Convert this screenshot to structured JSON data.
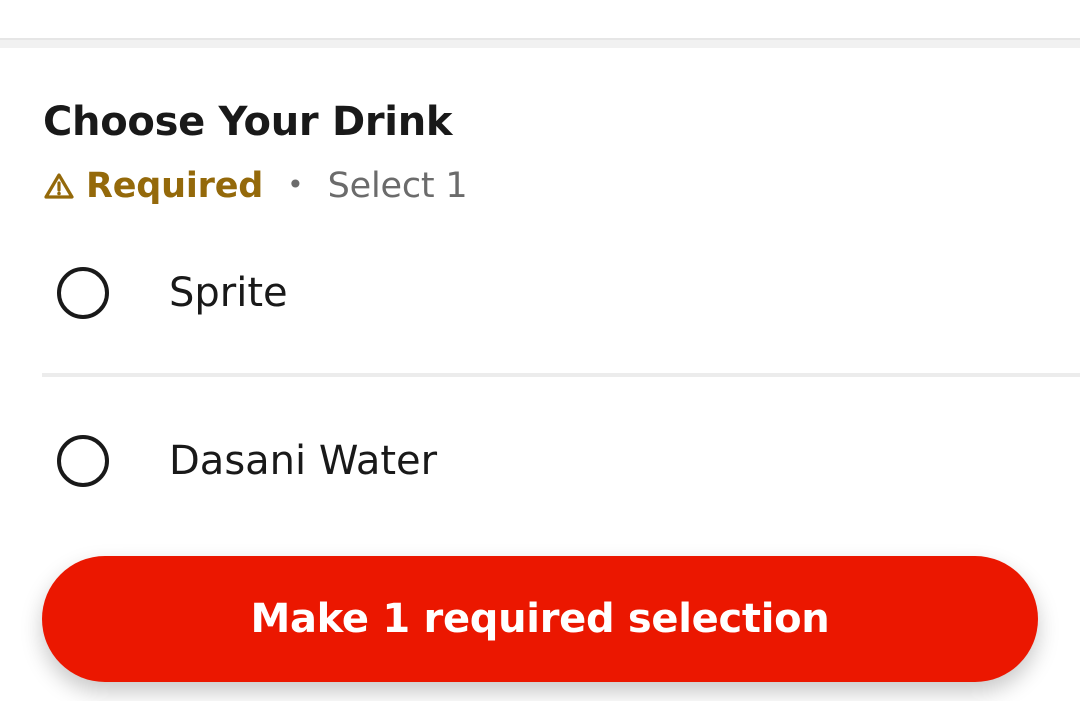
{
  "section": {
    "title": "Choose Your Drink",
    "required_label": "Required",
    "separator": "•",
    "select_hint": "Select 1"
  },
  "options": [
    {
      "label": "Sprite",
      "selected": false
    },
    {
      "label": "Dasani Water",
      "selected": false
    }
  ],
  "footer": {
    "cta_label": "Make 1 required selection"
  },
  "colors": {
    "accent": "#eb1700",
    "required": "#94690a",
    "secondary_text": "#6b6b6b",
    "primary_text": "#191919"
  },
  "icons": {
    "required": "warning-triangle-icon",
    "option": "radio-unchecked-icon"
  }
}
